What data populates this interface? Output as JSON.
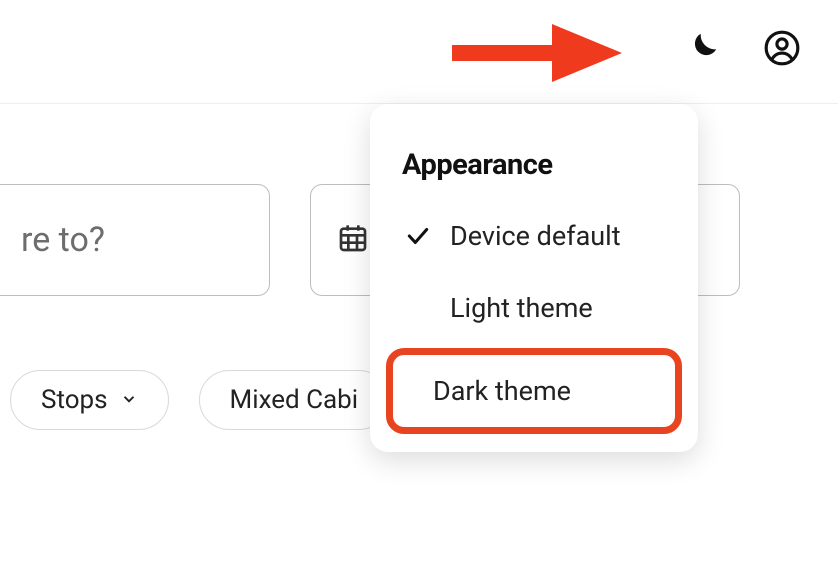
{
  "header": {
    "theme_icon": "moon-icon",
    "profile_icon": "user-circle-icon"
  },
  "annotation": {
    "arrow_color": "#ef3a1e"
  },
  "search": {
    "where_placeholder": "re to?",
    "date_icon": "calendar-icon"
  },
  "filters": {
    "stops_label": "Stops",
    "mixed_cabin_label": "Mixed Cabi"
  },
  "popover": {
    "title": "Appearance",
    "items": [
      {
        "label": "Device default",
        "selected": true
      },
      {
        "label": "Light theme",
        "selected": false
      },
      {
        "label": "Dark theme",
        "selected": false,
        "highlighted": true
      }
    ]
  }
}
